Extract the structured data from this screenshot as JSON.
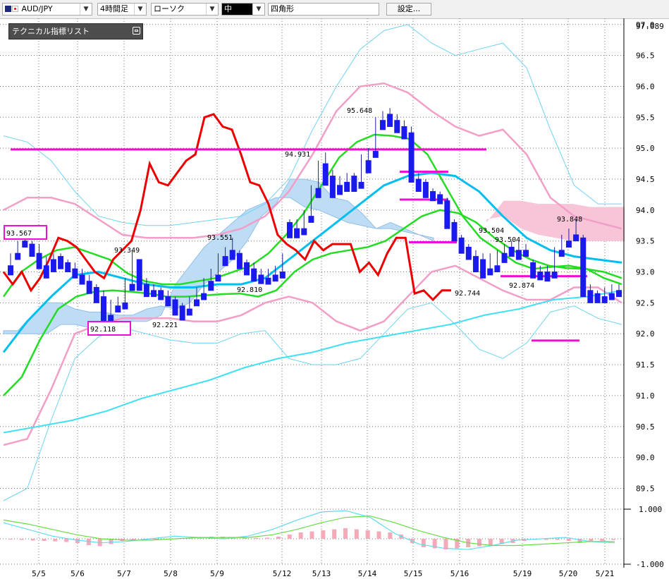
{
  "toolbar": {
    "symbol": "AUD/JPY",
    "timeframe": "4時間足",
    "chart_style": "ローソク",
    "line_width": "中",
    "shape": "四角形",
    "settings_label": "設定..."
  },
  "indicator_panel": {
    "title": "テクニカル指標リスト"
  },
  "colors": {
    "up_candle": "#e05a6a",
    "down_candle": "#1a1aee",
    "bollinger_mid": "#00bfef",
    "bollinger_1sigma": "#f29ec6",
    "bollinger_2sigma": "#6fd3f3",
    "short_ma": "#22dd22",
    "long_ma": "#22dd22",
    "lagging_line": "#ee0000",
    "kumo_bull": "#bfdcf5",
    "kumo_bear": "#f7c4d8",
    "horizontal_lines": "#ee10d0"
  },
  "chart_data": {
    "type": "candlestick",
    "symbol": "AUD/JPY",
    "timeframe": "4時間足",
    "ylim": [
      89.3,
      97.1
    ],
    "y_ticks": [
      "97.0",
      "96.5",
      "96.0",
      "95.5",
      "95.0",
      "94.5",
      "94.0",
      "93.5",
      "93.0",
      "92.5",
      "92.0",
      "91.5",
      "91.0",
      "90.5",
      "90.0",
      "89.5"
    ],
    "current_price_label": "97.089",
    "x_labels": [
      "5/5",
      "5/6",
      "5/7",
      "5/8",
      "5/9",
      "5/12",
      "5/13",
      "5/14",
      "5/15",
      "5/16",
      "5/19",
      "5/20",
      "5/21"
    ],
    "price_labels": [
      "93.567",
      "93.349",
      "92.118",
      "92.221",
      "93.551",
      "92.810",
      "94.931",
      "95.648",
      "92.744",
      "93.504",
      "93.504",
      "92.874",
      "93.848"
    ],
    "candles": [
      [
        93.1,
        93.3,
        93.0,
        92.95
      ],
      [
        93.3,
        93.5,
        93.25,
        93.2
      ],
      [
        93.5,
        93.57,
        93.45,
        93.4
      ],
      [
        93.45,
        93.5,
        93.3,
        93.25
      ],
      [
        93.3,
        93.45,
        93.1,
        93.05
      ],
      [
        93.1,
        93.25,
        92.95,
        92.9
      ],
      [
        93.2,
        93.3,
        93.05,
        93.0
      ],
      [
        93.25,
        93.3,
        93.1,
        93.05
      ],
      [
        93.15,
        93.2,
        93.05,
        93.0
      ],
      [
        93.05,
        93.15,
        92.95,
        92.9
      ],
      [
        92.95,
        93.05,
        92.85,
        92.8
      ],
      [
        92.85,
        92.95,
        92.7,
        92.65
      ],
      [
        92.75,
        92.8,
        92.55,
        92.5
      ],
      [
        92.6,
        92.7,
        92.25,
        92.2
      ],
      [
        92.3,
        92.55,
        92.25,
        92.12
      ],
      [
        92.45,
        92.6,
        92.4,
        92.35
      ],
      [
        92.5,
        92.9,
        92.45,
        92.4
      ],
      [
        92.8,
        93.35,
        92.75,
        92.7
      ],
      [
        93.2,
        93.2,
        92.75,
        92.7
      ],
      [
        92.8,
        92.9,
        92.65,
        92.6
      ],
      [
        92.7,
        92.8,
        92.65,
        92.6
      ],
      [
        92.7,
        92.75,
        92.6,
        92.55
      ],
      [
        92.6,
        92.7,
        92.5,
        92.45
      ],
      [
        92.55,
        92.6,
        92.4,
        92.3
      ],
      [
        92.45,
        92.5,
        92.3,
        92.22
      ],
      [
        92.4,
        92.6,
        92.35,
        92.3
      ],
      [
        92.55,
        92.75,
        92.5,
        92.45
      ],
      [
        92.65,
        92.9,
        92.6,
        92.55
      ],
      [
        92.85,
        93.05,
        92.8,
        92.7
      ],
      [
        92.95,
        93.3,
        92.9,
        92.85
      ],
      [
        93.25,
        93.4,
        93.2,
        93.1
      ],
      [
        93.35,
        93.55,
        93.3,
        93.2
      ],
      [
        93.3,
        93.35,
        93.1,
        93.05
      ],
      [
        93.15,
        93.2,
        93.0,
        92.95
      ],
      [
        93.05,
        93.15,
        92.95,
        92.85
      ],
      [
        92.95,
        93.05,
        92.85,
        92.81
      ],
      [
        92.9,
        93.05,
        92.85,
        92.8
      ],
      [
        92.95,
        93.1,
        92.9,
        92.85
      ],
      [
        93.0,
        93.3,
        92.95,
        92.9
      ],
      [
        93.8,
        93.85,
        93.6,
        93.55
      ],
      [
        93.7,
        93.85,
        93.6,
        93.55
      ],
      [
        93.7,
        94.0,
        93.65,
        93.6
      ],
      [
        93.9,
        94.4,
        93.85,
        93.8
      ],
      [
        94.35,
        94.8,
        94.3,
        94.2
      ],
      [
        94.75,
        94.93,
        94.5,
        94.4
      ],
      [
        94.55,
        94.65,
        94.3,
        94.2
      ],
      [
        94.4,
        94.55,
        94.35,
        94.25
      ],
      [
        94.45,
        94.6,
        94.4,
        94.3
      ],
      [
        94.55,
        94.6,
        94.4,
        94.3
      ],
      [
        94.45,
        94.9,
        94.4,
        94.35
      ],
      [
        94.8,
        95.0,
        94.7,
        94.6
      ],
      [
        94.95,
        95.5,
        94.9,
        94.85
      ],
      [
        95.45,
        95.6,
        95.4,
        95.3
      ],
      [
        95.55,
        95.65,
        95.4,
        95.35
      ],
      [
        95.45,
        95.55,
        95.3,
        95.25
      ],
      [
        95.35,
        95.45,
        95.25,
        95.15
      ],
      [
        95.25,
        95.35,
        94.5,
        94.45
      ],
      [
        94.5,
        94.6,
        94.4,
        94.3
      ],
      [
        94.45,
        94.5,
        94.25,
        94.2
      ],
      [
        94.3,
        94.35,
        94.2,
        94.15
      ],
      [
        94.25,
        94.3,
        94.15,
        94.1
      ],
      [
        94.15,
        94.2,
        93.75,
        93.7
      ],
      [
        93.8,
        93.85,
        93.55,
        93.5
      ],
      [
        93.55,
        93.6,
        93.35,
        93.3
      ],
      [
        93.4,
        93.45,
        93.25,
        93.2
      ],
      [
        93.25,
        93.35,
        93.1,
        93.0
      ],
      [
        93.2,
        93.3,
        92.95,
        92.9
      ],
      [
        93.05,
        93.3,
        93.0,
        92.95
      ],
      [
        93.1,
        93.35,
        93.05,
        93.0
      ],
      [
        93.3,
        93.45,
        93.2,
        93.15
      ],
      [
        93.4,
        93.5,
        93.3,
        93.25
      ],
      [
        93.35,
        93.5,
        93.3,
        93.2
      ],
      [
        93.35,
        93.45,
        93.3,
        93.25
      ],
      [
        93.15,
        93.2,
        92.95,
        92.9
      ],
      [
        93.0,
        93.1,
        92.95,
        92.87
      ],
      [
        93.0,
        93.1,
        92.9,
        92.85
      ],
      [
        93.0,
        93.4,
        92.95,
        92.9
      ],
      [
        93.35,
        93.6,
        93.3,
        93.25
      ],
      [
        93.5,
        93.7,
        93.45,
        93.4
      ],
      [
        93.6,
        93.85,
        93.55,
        93.5
      ],
      [
        93.55,
        93.6,
        92.7,
        92.6
      ],
      [
        92.7,
        92.8,
        92.6,
        92.5
      ],
      [
        92.65,
        92.7,
        92.55,
        92.5
      ],
      [
        92.6,
        92.75,
        92.55,
        92.5
      ],
      [
        92.65,
        92.8,
        92.6,
        92.55
      ],
      [
        92.7,
        92.8,
        92.65,
        92.6
      ]
    ],
    "series": [
      {
        "name": "short_ma",
        "values": [
          92.6,
          93.0,
          93.2,
          93.35,
          93.4,
          93.3,
          93.2,
          92.98,
          92.85,
          92.8,
          92.8,
          92.85,
          92.9,
          93.0,
          93.1,
          93.3,
          93.6,
          93.95,
          94.4,
          94.85,
          95.1,
          95.22,
          95.2,
          95.15,
          94.9,
          94.4,
          93.9,
          93.55,
          93.35,
          93.15,
          93.05,
          93.08,
          93.1,
          93.05,
          92.9,
          92.8
        ]
      },
      {
        "name": "long_ma",
        "values": [
          91.0,
          91.3,
          91.9,
          92.4,
          92.6,
          92.68,
          92.7,
          92.68,
          92.65,
          92.6,
          92.6,
          92.62,
          92.64,
          92.65,
          92.6,
          92.7,
          93.0,
          93.2,
          93.3,
          93.35,
          93.4,
          93.5,
          93.7,
          93.9,
          94.0,
          93.95,
          93.8,
          93.55,
          93.35,
          93.2,
          93.1,
          93.06,
          93.05,
          93.0,
          92.9
        ]
      },
      {
        "name": "bollinger_mid",
        "values": [
          91.7,
          92.2,
          92.6,
          92.95,
          93.0,
          92.9,
          92.8,
          92.75,
          92.75,
          92.8,
          92.8,
          92.9,
          93.2,
          93.5,
          93.8,
          94.1,
          94.4,
          94.55,
          94.6,
          94.55,
          94.3,
          93.9,
          93.55,
          93.35,
          93.25,
          93.2,
          93.15
        ]
      },
      {
        "name": "lagging_line",
        "values": [
          93.0,
          92.7,
          93.5,
          93.0,
          93.3,
          94.7,
          94.5,
          95.5,
          95.3,
          94.3,
          93.8,
          93.3,
          93.2,
          93.4,
          93.5,
          92.9,
          93.1,
          93.6,
          93.5,
          92.6,
          92.7
        ]
      }
    ]
  },
  "macd": {
    "y_ticks": [
      "1.000",
      "-1.000"
    ]
  }
}
